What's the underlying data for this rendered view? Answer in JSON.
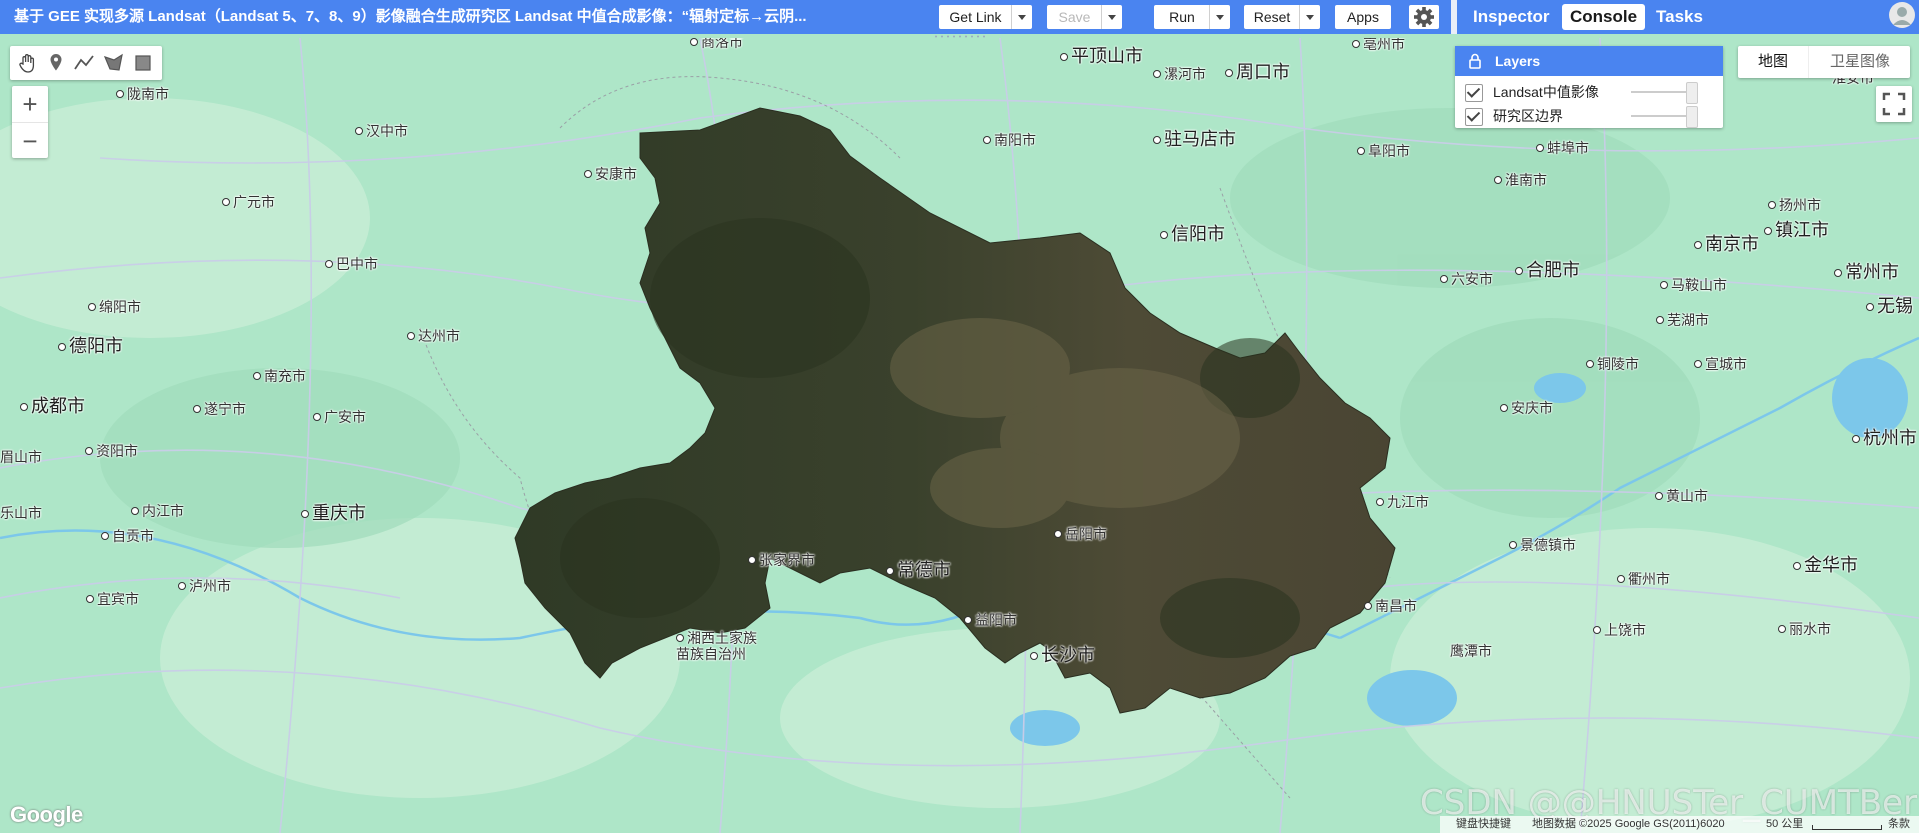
{
  "header": {
    "title": "基于 GEE 实现多源 Landsat（Landsat 5、7、8、9）影像融合生成研究区 Landsat 中值合成影像：“辐射定标→云阴...",
    "buttons": {
      "get_link": "Get Link",
      "save": "Save",
      "run": "Run",
      "reset": "Reset",
      "apps": "Apps"
    },
    "tabs": [
      "Inspector",
      "Console",
      "Tasks"
    ],
    "active_tab": "Console"
  },
  "map": {
    "layers_title": "Layers",
    "layers": [
      {
        "label": "Landsat中值影像",
        "checked": true
      },
      {
        "label": "研究区边界",
        "checked": true
      }
    ],
    "map_types": [
      "地图",
      "卫星图像"
    ],
    "selected_map_type": "地图",
    "zoom": {
      "in": "+",
      "out": "−"
    },
    "places": [
      {
        "name": "商洛市",
        "big": false
      },
      {
        "name": "平顶山市",
        "big": true
      },
      {
        "name": "漯河市",
        "big": false
      },
      {
        "name": "周口市",
        "big": true
      },
      {
        "name": "亳州市",
        "big": false
      },
      {
        "name": "陇南市",
        "big": false
      },
      {
        "name": "汉中市",
        "big": false
      },
      {
        "name": "南阳市",
        "big": false
      },
      {
        "name": "驻马店市",
        "big": true
      },
      {
        "name": "阜阳市",
        "big": false
      },
      {
        "name": "蚌埠市",
        "big": false
      },
      {
        "name": "淮安市",
        "big": false
      },
      {
        "name": "安康市",
        "big": false
      },
      {
        "name": "广元市",
        "big": false
      },
      {
        "name": "淮南市",
        "big": false
      },
      {
        "name": "扬州市",
        "big": false
      },
      {
        "name": "镇江市",
        "big": true
      },
      {
        "name": "信阳市",
        "big": true
      },
      {
        "name": "南京市",
        "big": true
      },
      {
        "name": "巴中市",
        "big": false
      },
      {
        "name": "六安市",
        "big": false
      },
      {
        "name": "合肥市",
        "big": true
      },
      {
        "name": "常州市",
        "big": true
      },
      {
        "name": "马鞍山市",
        "big": false
      },
      {
        "name": "无锡",
        "big": true
      },
      {
        "name": "绵阳市",
        "big": false
      },
      {
        "name": "芜湖市",
        "big": false
      },
      {
        "name": "德阳市",
        "big": true
      },
      {
        "name": "达州市",
        "big": false
      },
      {
        "name": "铜陵市",
        "big": false
      },
      {
        "name": "宣城市",
        "big": false
      },
      {
        "name": "南充市",
        "big": false
      },
      {
        "name": "成都市",
        "big": true
      },
      {
        "name": "遂宁市",
        "big": false
      },
      {
        "name": "广安市",
        "big": false
      },
      {
        "name": "安庆市",
        "big": false
      },
      {
        "name": "杭州市",
        "big": true
      },
      {
        "name": "眉山市",
        "big": false
      },
      {
        "name": "资阳市",
        "big": false
      },
      {
        "name": "九江市",
        "big": false
      },
      {
        "name": "黄山市",
        "big": false
      },
      {
        "name": "乐山市",
        "big": false
      },
      {
        "name": "内江市",
        "big": false
      },
      {
        "name": "重庆市",
        "big": true
      },
      {
        "name": "自贡市",
        "big": false
      },
      {
        "name": "岳阳市",
        "big": false
      },
      {
        "name": "景德镇市",
        "big": false
      },
      {
        "name": "张家界市",
        "big": false
      },
      {
        "name": "常德市",
        "big": true
      },
      {
        "name": "金华市",
        "big": true
      },
      {
        "name": "泸州市",
        "big": false
      },
      {
        "name": "衢州市",
        "big": false
      },
      {
        "name": "宜宾市",
        "big": false
      },
      {
        "name": "南昌市",
        "big": false
      },
      {
        "name": "益阳市",
        "big": false
      },
      {
        "name": "上饶市",
        "big": false
      },
      {
        "name": "丽水市",
        "big": false
      },
      {
        "name": "湘西土家族",
        "big": false
      },
      {
        "name": "苗族自治州",
        "big": false
      },
      {
        "name": "长沙市",
        "big": true
      },
      {
        "name": "鹰潭市",
        "big": false
      }
    ],
    "footer": {
      "shortcuts": "键盘快捷键",
      "attribution": "地图数据 ©2025 Google GS(2011)6020",
      "scale": "50 公里",
      "terms": "条款"
    },
    "google_logo": "Google",
    "watermark": "CSDN @@HNUSTer_CUMTBer"
  }
}
